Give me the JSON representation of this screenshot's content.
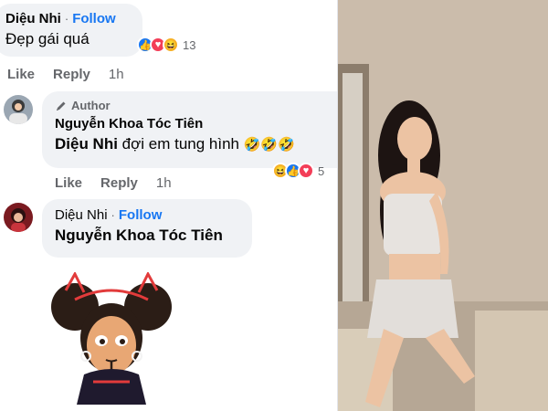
{
  "comments": [
    {
      "name": "Diệu Nhi",
      "dot": "·",
      "follow": "Follow",
      "text": "Đẹp gái quá",
      "reaction_count": "13",
      "like": "Like",
      "reply": "Reply",
      "time": "1h"
    },
    {
      "badge": "Author",
      "name": "Nguyễn Khoa Tóc Tiên",
      "mention": "Diệu Nhi",
      "text": " đợi em tung hình",
      "emojis": "🤣🤣🤣",
      "reaction_count": "5",
      "like": "Like",
      "reply": "Reply",
      "time": "1h"
    },
    {
      "name": "Diệu Nhi",
      "dot": "·",
      "follow": "Follow",
      "text": "Nguyễn Khoa Tóc Tiên"
    }
  ],
  "colors": {
    "accent": "#1877f2",
    "bubble": "#f0f2f5",
    "meta": "#65676b"
  }
}
